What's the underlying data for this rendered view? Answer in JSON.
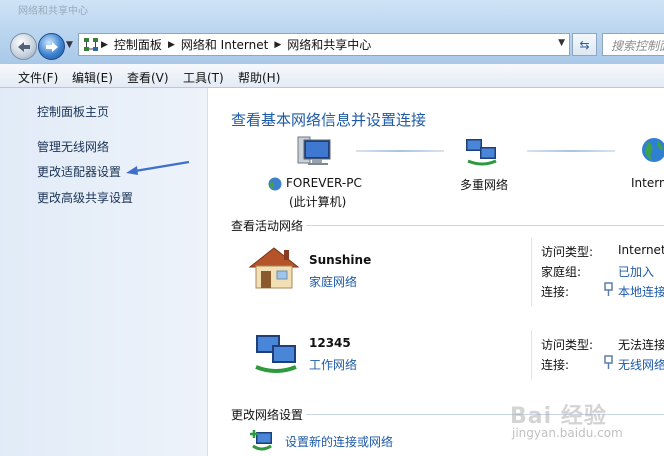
{
  "window": {
    "title": "网络和共享中心"
  },
  "address_bar": {
    "crumbs": [
      "控制面板",
      "网络和 Internet",
      "网络和共享中心"
    ]
  },
  "search": {
    "placeholder": "搜索控制面"
  },
  "menu": [
    "文件(F)",
    "编辑(E)",
    "查看(V)",
    "工具(T)",
    "帮助(H)"
  ],
  "sidebar": {
    "links": [
      "控制面板主页",
      "管理无线网络",
      "更改适配器设置",
      "更改高级共享设置"
    ]
  },
  "main": {
    "title": "查看基本网络信息并设置连接",
    "map": {
      "computer_name": "FOREVER-PC",
      "computer_sub": "(此计算机)",
      "middle": "多重网络",
      "internet": "Internet"
    },
    "active_header": "查看活动网络",
    "networks": [
      {
        "name": "Sunshine",
        "type": "家庭网络",
        "access_label": "访问类型:",
        "access_value": "Internet",
        "homegroup_label": "家庭组:",
        "homegroup_value": "已加入",
        "conn_label": "连接:",
        "conn_value": "本地连接"
      },
      {
        "name": "12345",
        "type": "工作网络",
        "access_label": "访问类型:",
        "access_value": "无法连接到",
        "conn_label": "连接:",
        "conn_value": "无线网络"
      }
    ],
    "change_header": "更改网络设置",
    "tasks": [
      "设置新的连接或网络"
    ]
  },
  "watermark": {
    "text": "Bai 经验",
    "url": "jingyan.baidu.com"
  },
  "colors": {
    "link": "#1e5aa8",
    "title": "#1e5aa8",
    "sidebar_bg": "#e6eef8"
  }
}
